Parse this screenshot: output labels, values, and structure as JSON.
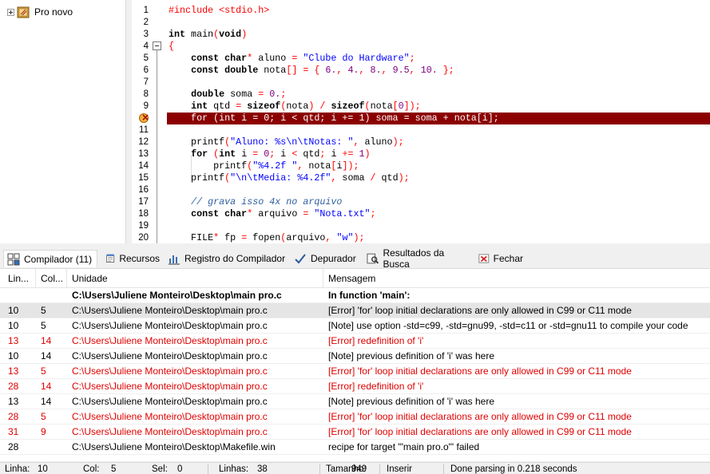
{
  "project_tree": {
    "project_name": "Pro novo"
  },
  "editor": {
    "lines": [
      {
        "n": "1",
        "parts": [
          [
            "p",
            "#include <stdio.h>"
          ]
        ]
      },
      {
        "n": "2",
        "parts": []
      },
      {
        "n": "3",
        "parts": [
          [
            "k",
            "int"
          ],
          [
            "t",
            " main"
          ],
          [
            "p",
            "("
          ],
          [
            "k",
            "void"
          ],
          [
            "p",
            ")"
          ]
        ]
      },
      {
        "n": "4",
        "parts": [
          [
            "p",
            "{"
          ]
        ]
      },
      {
        "n": "5",
        "parts": [
          [
            "t",
            "    "
          ],
          [
            "k",
            "const char"
          ],
          [
            "p",
            "*"
          ],
          [
            "t",
            " aluno "
          ],
          [
            "p",
            "="
          ],
          [
            "t",
            " "
          ],
          [
            "s",
            "\"Clube do Hardware\""
          ],
          [
            "p",
            ";"
          ]
        ]
      },
      {
        "n": "6",
        "parts": [
          [
            "t",
            "    "
          ],
          [
            "k",
            "const double"
          ],
          [
            "t",
            " nota"
          ],
          [
            "p",
            "[]"
          ],
          [
            "t",
            " "
          ],
          [
            "p",
            "="
          ],
          [
            "t",
            " "
          ],
          [
            "p",
            "{"
          ],
          [
            "t",
            " "
          ],
          [
            "n",
            "6."
          ],
          [
            "p",
            ","
          ],
          [
            "t",
            " "
          ],
          [
            "n",
            "4."
          ],
          [
            "p",
            ","
          ],
          [
            "t",
            " "
          ],
          [
            "n",
            "8."
          ],
          [
            "p",
            ","
          ],
          [
            "t",
            " "
          ],
          [
            "n",
            "9.5"
          ],
          [
            "p",
            ","
          ],
          [
            "t",
            " "
          ],
          [
            "n",
            "10."
          ],
          [
            "t",
            " "
          ],
          [
            "p",
            "};"
          ]
        ]
      },
      {
        "n": "7",
        "parts": []
      },
      {
        "n": "8",
        "parts": [
          [
            "t",
            "    "
          ],
          [
            "k",
            "double"
          ],
          [
            "t",
            " soma "
          ],
          [
            "p",
            "="
          ],
          [
            "t",
            " "
          ],
          [
            "n",
            "0."
          ],
          [
            "p",
            ";"
          ]
        ]
      },
      {
        "n": "9",
        "parts": [
          [
            "t",
            "    "
          ],
          [
            "k",
            "int"
          ],
          [
            "t",
            " qtd "
          ],
          [
            "p",
            "="
          ],
          [
            "t",
            " "
          ],
          [
            "k",
            "sizeof"
          ],
          [
            "p",
            "("
          ],
          [
            "t",
            "nota"
          ],
          [
            "p",
            ")"
          ],
          [
            "t",
            " "
          ],
          [
            "p",
            "/"
          ],
          [
            "t",
            " "
          ],
          [
            "k",
            "sizeof"
          ],
          [
            "p",
            "("
          ],
          [
            "t",
            "nota"
          ],
          [
            "p",
            "["
          ],
          [
            "n",
            "0"
          ],
          [
            "p",
            "]);"
          ]
        ]
      },
      {
        "n": "10",
        "parts": [
          [
            "t",
            "    for (int i = 0; i < qtd; i += 1) soma = soma + nota[i];"
          ]
        ]
      },
      {
        "n": "11",
        "parts": []
      },
      {
        "n": "12",
        "parts": [
          [
            "t",
            "    printf"
          ],
          [
            "p",
            "("
          ],
          [
            "s",
            "\"Aluno: %s\\n\\tNotas: \""
          ],
          [
            "p",
            ","
          ],
          [
            "t",
            " aluno"
          ],
          [
            "p",
            ");"
          ]
        ]
      },
      {
        "n": "13",
        "parts": [
          [
            "t",
            "    "
          ],
          [
            "k",
            "for"
          ],
          [
            "t",
            " "
          ],
          [
            "p",
            "("
          ],
          [
            "k",
            "int"
          ],
          [
            "t",
            " i "
          ],
          [
            "p",
            "="
          ],
          [
            "t",
            " "
          ],
          [
            "n",
            "0"
          ],
          [
            "p",
            ";"
          ],
          [
            "t",
            " i "
          ],
          [
            "p",
            "<"
          ],
          [
            "t",
            " qtd"
          ],
          [
            "p",
            ";"
          ],
          [
            "t",
            " i "
          ],
          [
            "p",
            "+="
          ],
          [
            "t",
            " "
          ],
          [
            "n",
            "1"
          ],
          [
            "p",
            ")"
          ]
        ]
      },
      {
        "n": "14",
        "parts": [
          [
            "t",
            "        printf"
          ],
          [
            "p",
            "("
          ],
          [
            "s",
            "\"%4.2f \""
          ],
          [
            "p",
            ","
          ],
          [
            "t",
            " nota"
          ],
          [
            "p",
            "["
          ],
          [
            "t",
            "i"
          ],
          [
            "p",
            "]);"
          ]
        ]
      },
      {
        "n": "15",
        "parts": [
          [
            "t",
            "    printf"
          ],
          [
            "p",
            "("
          ],
          [
            "s",
            "\"\\n\\tMedia: %4.2f\""
          ],
          [
            "p",
            ","
          ],
          [
            "t",
            " soma "
          ],
          [
            "p",
            "/"
          ],
          [
            "t",
            " qtd"
          ],
          [
            "p",
            ");"
          ]
        ]
      },
      {
        "n": "16",
        "parts": []
      },
      {
        "n": "17",
        "parts": [
          [
            "t",
            "    "
          ],
          [
            "c",
            "// grava isso 4x no arquivo"
          ]
        ]
      },
      {
        "n": "18",
        "parts": [
          [
            "t",
            "    "
          ],
          [
            "k",
            "const char"
          ],
          [
            "p",
            "*"
          ],
          [
            "t",
            " arquivo "
          ],
          [
            "p",
            "="
          ],
          [
            "t",
            " "
          ],
          [
            "s",
            "\"Nota.txt\""
          ],
          [
            "p",
            ";"
          ]
        ]
      },
      {
        "n": "19",
        "parts": []
      },
      {
        "n": "20",
        "parts": [
          [
            "t",
            "    FILE"
          ],
          [
            "p",
            "*"
          ],
          [
            "t",
            " fp "
          ],
          [
            "p",
            "="
          ],
          [
            "t",
            " fopen"
          ],
          [
            "p",
            "("
          ],
          [
            "t",
            "arquivo"
          ],
          [
            "p",
            ","
          ],
          [
            "t",
            " "
          ],
          [
            "s",
            "\"w\""
          ],
          [
            "p",
            ");"
          ]
        ]
      }
    ]
  },
  "tabs": [
    {
      "label": "Compilador (11)",
      "icon": "compiler-grid-icon"
    },
    {
      "label": "Recursos",
      "icon": "resources-icon"
    },
    {
      "label": "Registro do Compilador",
      "icon": "compile-log-chart-icon"
    },
    {
      "label": "Depurador",
      "icon": "debugger-check-icon"
    },
    {
      "label": "Resultados da Busca",
      "icon": "search-results-icon"
    },
    {
      "label": "Fechar",
      "icon": "close-icon"
    }
  ],
  "messages": {
    "headers": [
      "Lin...",
      "Col...",
      "Unidade",
      "Mensagem"
    ],
    "rows": [
      {
        "line": "",
        "col": "",
        "unit": "C:\\Users\\Juliene Monteiro\\Desktop\\main pro.c",
        "msg": "In function 'main':",
        "style": "bold"
      },
      {
        "line": "10",
        "col": "5",
        "unit": "C:\\Users\\Juliene Monteiro\\Desktop\\main pro.c",
        "msg": "[Error] 'for' loop initial declarations are only allowed in C99 or C11 mode",
        "style": "sel"
      },
      {
        "line": "10",
        "col": "5",
        "unit": "C:\\Users\\Juliene Monteiro\\Desktop\\main pro.c",
        "msg": "[Note] use option -std=c99, -std=gnu99, -std=c11 or -std=gnu11 to compile your code",
        "style": "normal"
      },
      {
        "line": "13",
        "col": "14",
        "unit": "C:\\Users\\Juliene Monteiro\\Desktop\\main pro.c",
        "msg": "[Error] redefinition of 'i'",
        "style": "red"
      },
      {
        "line": "10",
        "col": "14",
        "unit": "C:\\Users\\Juliene Monteiro\\Desktop\\main pro.c",
        "msg": "[Note] previous definition of 'i' was here",
        "style": "normal"
      },
      {
        "line": "13",
        "col": "5",
        "unit": "C:\\Users\\Juliene Monteiro\\Desktop\\main pro.c",
        "msg": "[Error] 'for' loop initial declarations are only allowed in C99 or C11 mode",
        "style": "red"
      },
      {
        "line": "28",
        "col": "14",
        "unit": "C:\\Users\\Juliene Monteiro\\Desktop\\main pro.c",
        "msg": "[Error] redefinition of 'i'",
        "style": "red"
      },
      {
        "line": "13",
        "col": "14",
        "unit": "C:\\Users\\Juliene Monteiro\\Desktop\\main pro.c",
        "msg": "[Note] previous definition of 'i' was here",
        "style": "normal"
      },
      {
        "line": "28",
        "col": "5",
        "unit": "C:\\Users\\Juliene Monteiro\\Desktop\\main pro.c",
        "msg": "[Error] 'for' loop initial declarations are only allowed in C99 or C11 mode",
        "style": "red"
      },
      {
        "line": "31",
        "col": "9",
        "unit": "C:\\Users\\Juliene Monteiro\\Desktop\\main pro.c",
        "msg": "[Error] 'for' loop initial declarations are only allowed in C99 or C11 mode",
        "style": "red"
      },
      {
        "line": "28",
        "col": "",
        "unit": "C:\\Users\\Juliene Monteiro\\Desktop\\Makefile.win",
        "msg": "recipe for target '\"main pro.o\"' failed",
        "style": "normal"
      }
    ]
  },
  "status": {
    "line_label": "Linha:",
    "line_value": "10",
    "col_label": "Col:",
    "col_value": "5",
    "sel_label": "Sel:",
    "sel_value": "0",
    "lines_label": "Linhas:",
    "lines_value": "38",
    "size_label": "Tamanho:",
    "size_value": "949",
    "mode": "Inserir",
    "message": "Done parsing in 0.218 seconds"
  },
  "colors": {
    "error_line_highlight": "#8b0000",
    "error_text": "#e00000",
    "string": "#0000ff",
    "number": "#800080"
  }
}
